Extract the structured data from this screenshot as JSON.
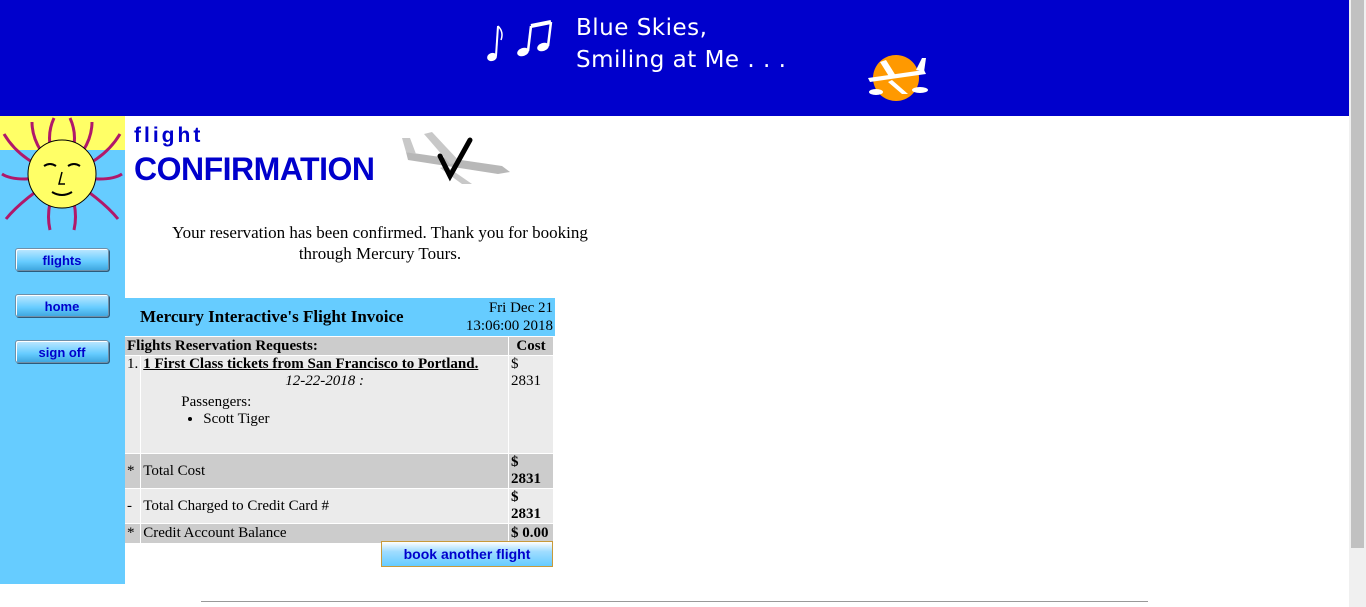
{
  "banner": {
    "tagline_line1": "Blue Skies,",
    "tagline_line2": "Smiling at Me . . .",
    "bg_color": "#0000cc"
  },
  "sidebar": {
    "bg_color": "#66ccff",
    "nav": [
      {
        "label": "flights"
      },
      {
        "label": "home"
      },
      {
        "label": "sign off"
      }
    ]
  },
  "page": {
    "title_small": "flight",
    "title_big": "CONFIRMATION",
    "confirmation_text": "Your reservation has been confirmed. Thank you for booking through Mercury Tours."
  },
  "invoice": {
    "title": "Mercury Interactive's Flight Invoice",
    "date_line1": "Fri Dec 21",
    "date_line2": "13:06:00 2018",
    "col_requests": "Flights Reservation Requests:",
    "col_cost": "Cost",
    "item_number": "1.",
    "item_title": "1 First Class tickets from San Francisco to Portland.",
    "item_date": "12-22-2018 :",
    "item_cost": "$ 2831",
    "passengers_label": "Passengers:",
    "passengers": [
      "Scott Tiger"
    ],
    "totals": [
      {
        "marker": "*",
        "label": "Total Cost",
        "amount": "$ 2831"
      },
      {
        "marker": "-",
        "label": "Total Charged to Credit Card #",
        "amount": "$ 2831"
      },
      {
        "marker": "*",
        "label": "Credit Account Balance",
        "amount": "$ 0.00"
      }
    ]
  },
  "actions": {
    "book_another": "book another flight"
  }
}
